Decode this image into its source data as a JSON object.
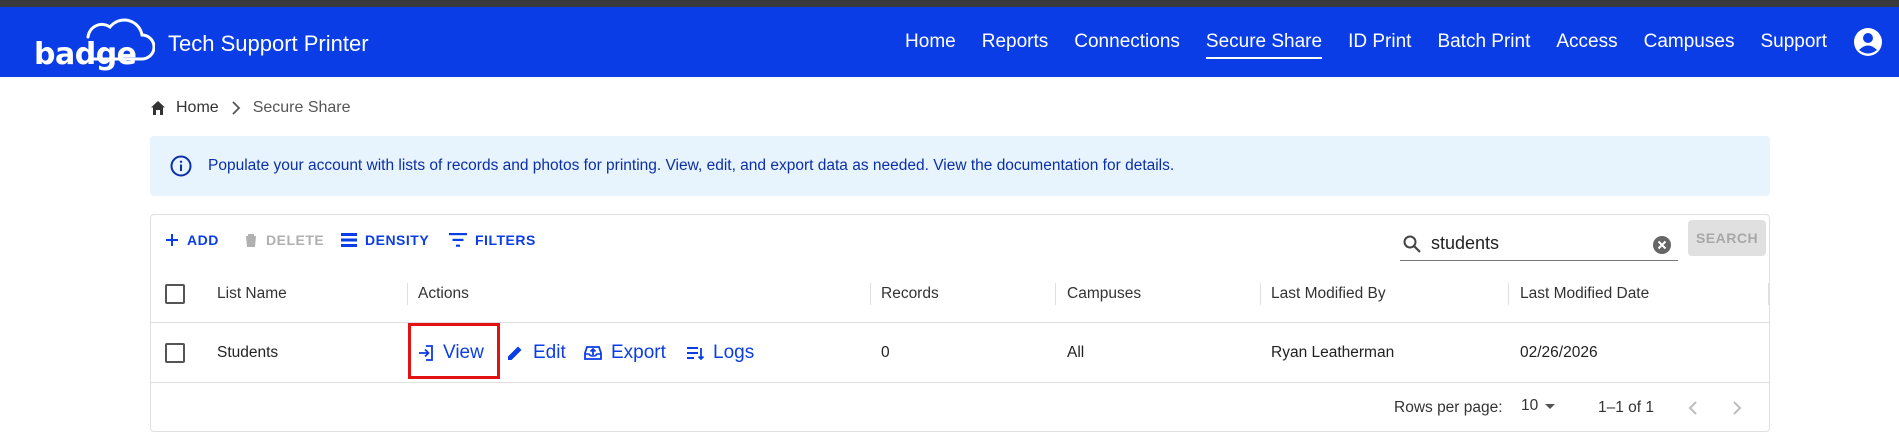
{
  "app": {
    "logo_text": "badge",
    "title": "Tech Support Printer",
    "brand_color": "#0a3de6"
  },
  "nav": {
    "items": [
      {
        "label": "Home"
      },
      {
        "label": "Reports"
      },
      {
        "label": "Connections"
      },
      {
        "label": "Secure Share",
        "active": true
      },
      {
        "label": "ID Print"
      },
      {
        "label": "Batch Print"
      },
      {
        "label": "Access"
      },
      {
        "label": "Campuses"
      },
      {
        "label": "Support"
      }
    ],
    "account_icon": "account-circle-icon"
  },
  "breadcrumb": {
    "home": "Home",
    "current": "Secure Share"
  },
  "alert": {
    "text": "Populate your account with lists of records and photos for printing. View, edit, and export data as needed. View the documentation for details.",
    "icon": "info-icon"
  },
  "toolbar": {
    "add": "ADD",
    "delete": "DELETE",
    "density": "DENSITY",
    "filters": "FILTERS",
    "search_value": "students",
    "search_button": "SEARCH"
  },
  "table": {
    "columns": [
      "List Name",
      "Actions",
      "Records",
      "Campuses",
      "Last Modified By",
      "Last Modified Date"
    ],
    "rows": [
      {
        "list_name": "Students",
        "actions": [
          "View",
          "Edit",
          "Export",
          "Logs"
        ],
        "records": "0",
        "campuses": "All",
        "last_modified_by": "Ryan Leatherman",
        "last_modified_date": "02/26/2026"
      }
    ]
  },
  "pagination": {
    "rows_per_page_label": "Rows per page:",
    "rows_per_page": "10",
    "range": "1–1 of 1"
  },
  "highlight_color": "#e21212"
}
